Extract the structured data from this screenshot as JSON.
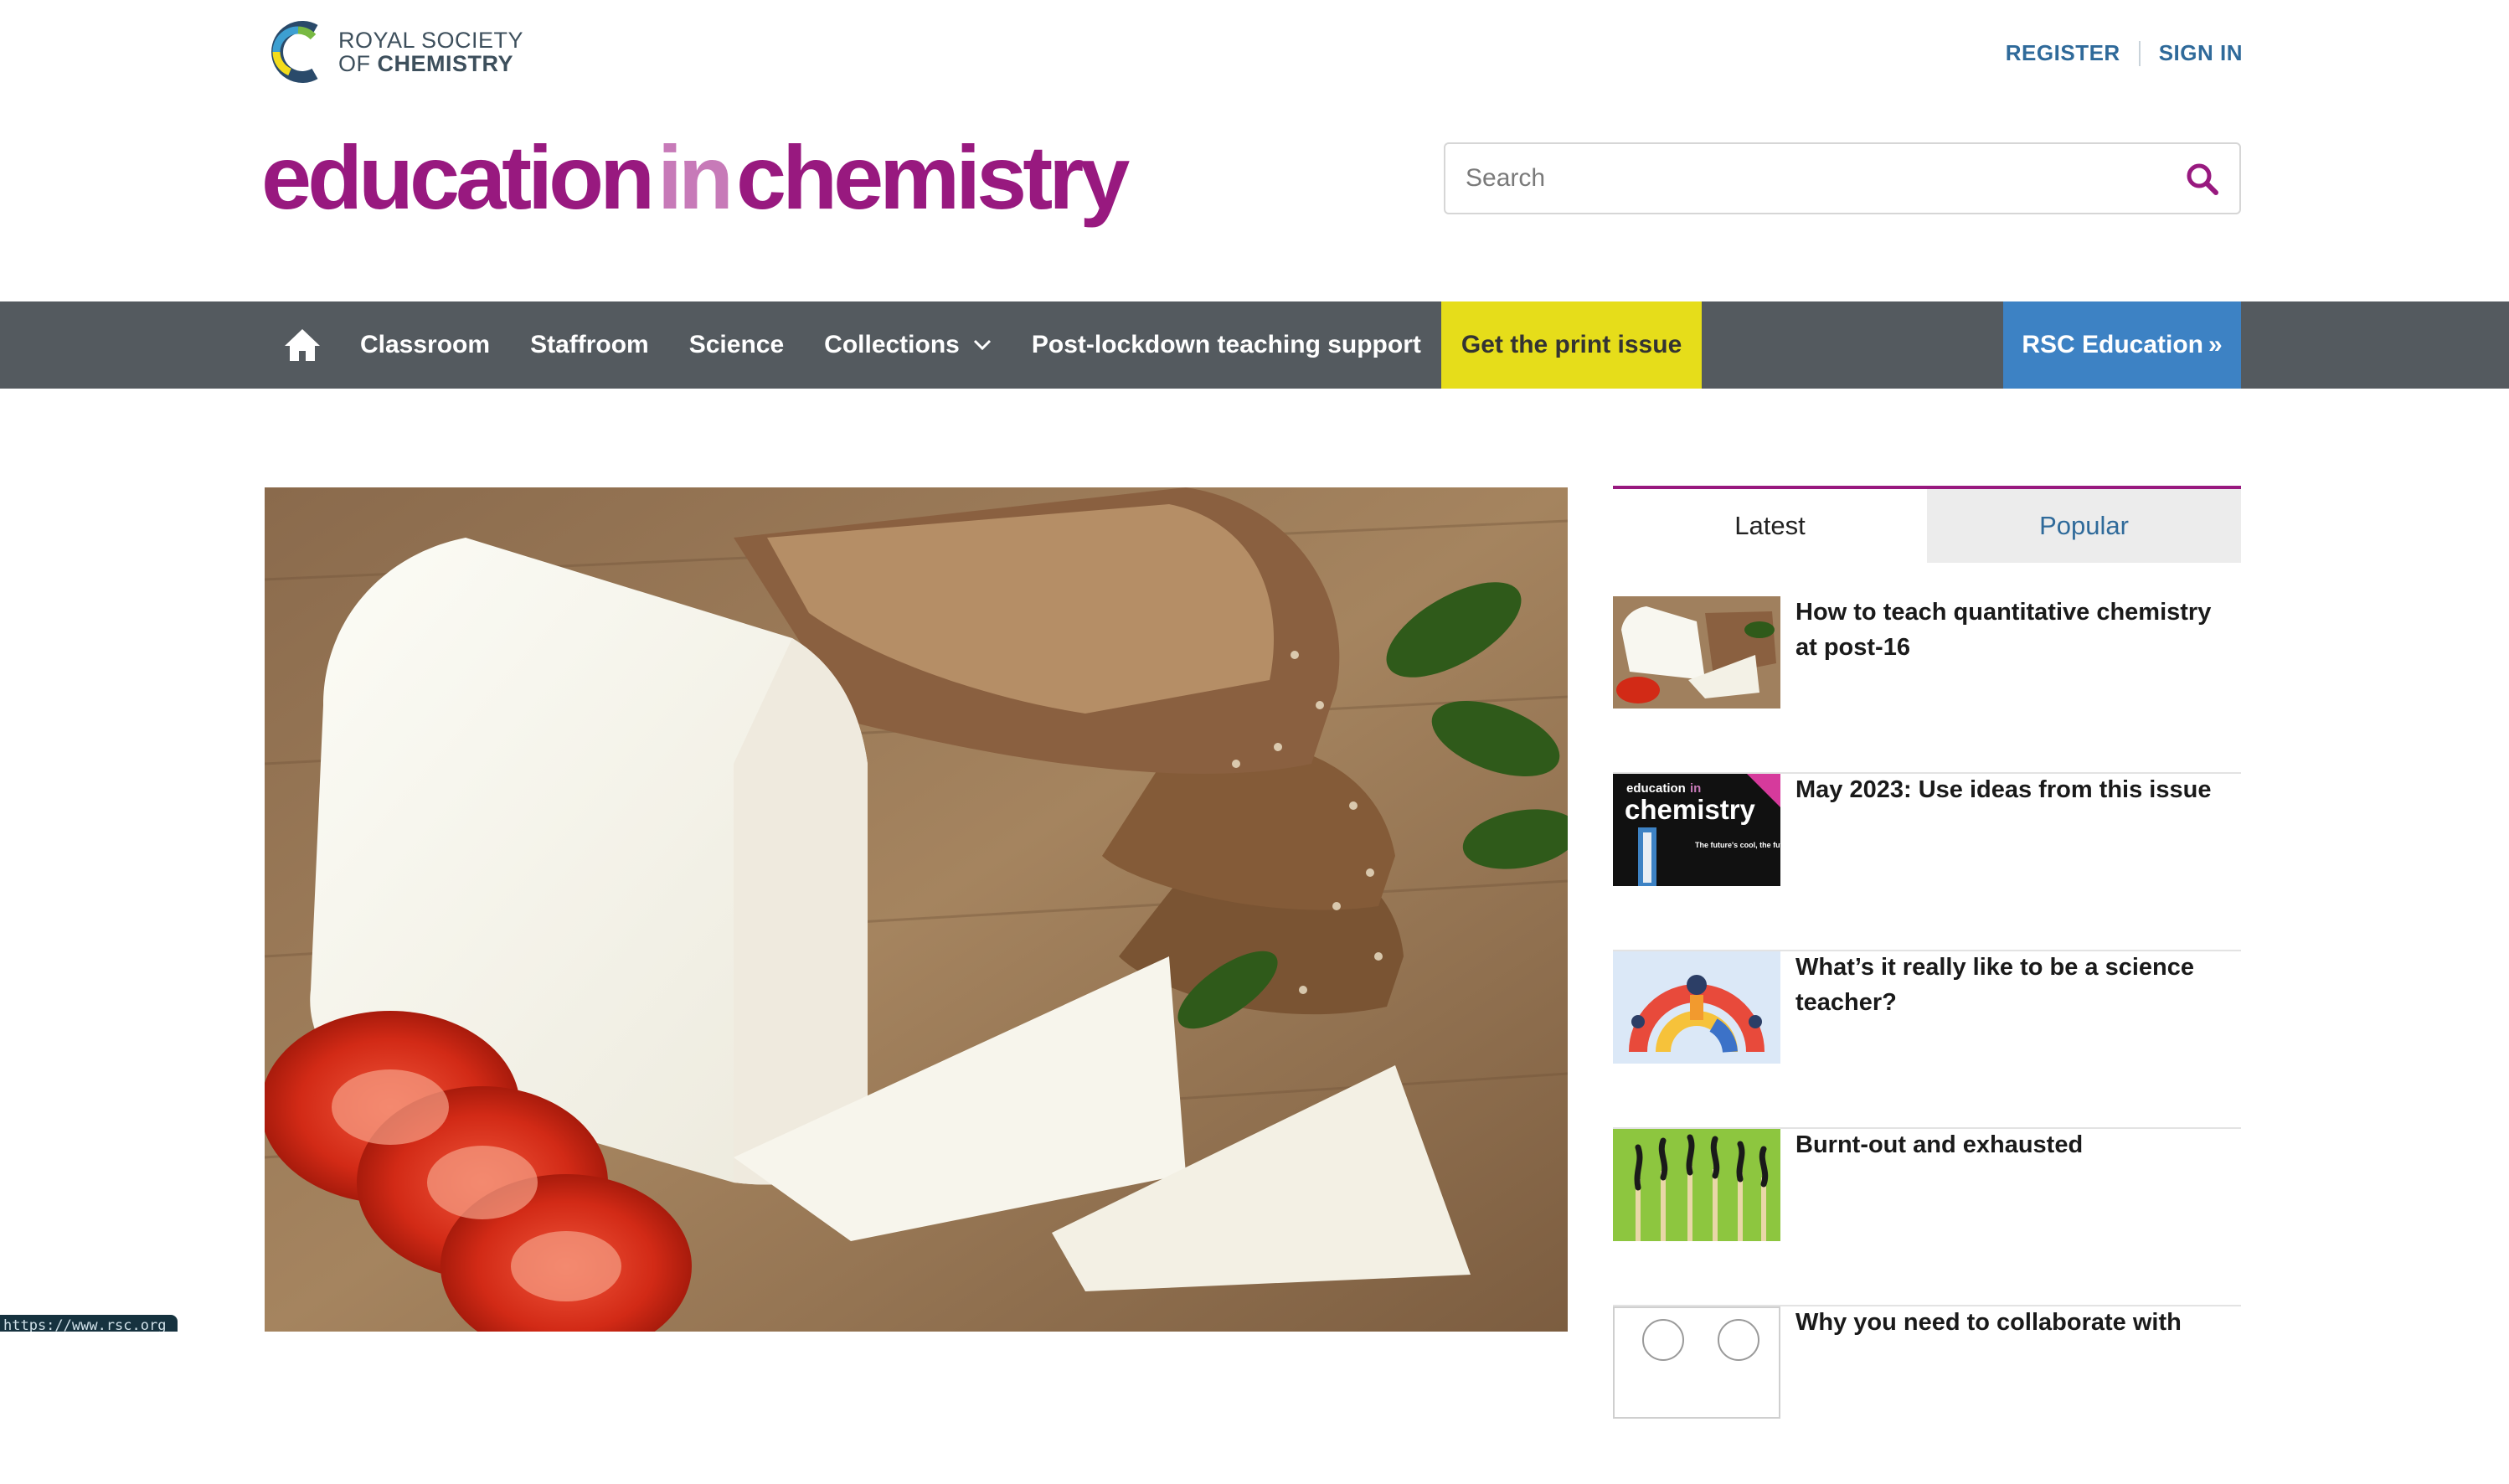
{
  "brand": {
    "rsc_line1": "ROYAL SOCIETY",
    "rsc_line2_prefix": "OF ",
    "rsc_line2_bold": "CHEMISTRY",
    "logo_icon": "rsc-c-icon",
    "title_part1": "education",
    "title_part2": "in",
    "title_part3": "chemistry",
    "colors": {
      "primary": "#98197f",
      "in": "#c77ab8",
      "link": "#2f6a9a",
      "nav": "#545a5f",
      "print": "#e6dd1a",
      "rsc_blue": "#3d82c4"
    }
  },
  "account": {
    "register": "REGISTER",
    "sign_in": "SIGN IN"
  },
  "search": {
    "placeholder": "Search",
    "value": "",
    "icon": "search-icon"
  },
  "nav": {
    "home_icon": "home-icon",
    "items": [
      "Classroom",
      "Staffroom",
      "Science",
      "Collections",
      "Post-lockdown teaching support"
    ],
    "print": "Get the print issue",
    "rsc_education": "RSC Education",
    "rsc_education_arrow": "»"
  },
  "hero": {
    "image": "cheese-bread-tomato-photo"
  },
  "sidebar": {
    "tabs": {
      "latest": "Latest",
      "popular": "Popular"
    },
    "articles": [
      {
        "title": "How to teach quantitative chemistry at post-16",
        "thumb": "cheese-thumbnail"
      },
      {
        "title": "May 2023: Use ideas from this issue",
        "thumb": "magazine-cover-thumbnail"
      },
      {
        "title": "What’s it really like to be a science teacher?",
        "thumb": "teachers-illustration-thumbnail"
      },
      {
        "title": "Burnt-out and exhausted",
        "thumb": "burnt-matches-thumbnail"
      },
      {
        "title": "Why you need to collaborate with",
        "thumb": "collaboration-thumbnail"
      }
    ],
    "mag_cover": {
      "line1": "education",
      "line1_in": "in",
      "line2": "chemistry",
      "tagline": "The future's cool, the future's green"
    }
  },
  "status_url": "https://www.rsc.org"
}
